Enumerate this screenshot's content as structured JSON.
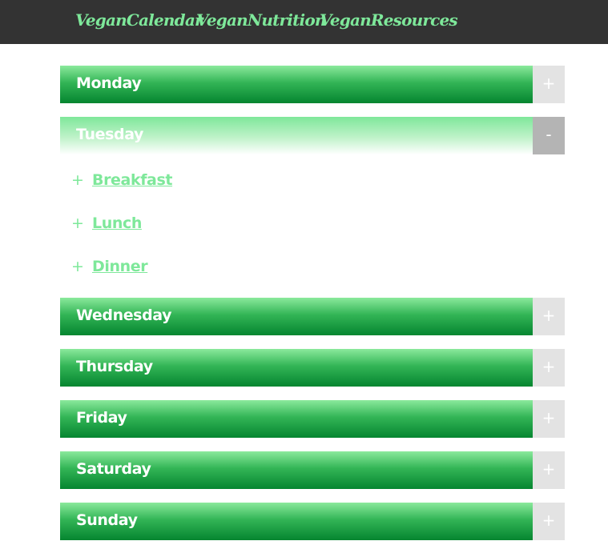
{
  "nav": {
    "items": [
      {
        "label": "VeganCalendar"
      },
      {
        "label": "VeganNutrition"
      },
      {
        "label": "VeganResources"
      }
    ]
  },
  "days": [
    {
      "label": "Monday",
      "toggle": "+",
      "expanded": false
    },
    {
      "label": "Tuesday",
      "toggle": "-",
      "expanded": true
    },
    {
      "label": "Wednesday",
      "toggle": "+",
      "expanded": false
    },
    {
      "label": "Thursday",
      "toggle": "+",
      "expanded": false
    },
    {
      "label": "Friday",
      "toggle": "+",
      "expanded": false
    },
    {
      "label": "Saturday",
      "toggle": "+",
      "expanded": false
    },
    {
      "label": "Sunday",
      "toggle": "+",
      "expanded": false
    }
  ],
  "tuesday_meals": [
    {
      "icon": "+",
      "label": "Breakfast"
    },
    {
      "icon": "+",
      "label": "Lunch"
    },
    {
      "icon": "+",
      "label": "Dinner"
    }
  ],
  "colors": {
    "nav_bg": "#333333",
    "nav_text": "#7ee89a",
    "bar_top": "#8be99c",
    "bar_bottom": "#058530",
    "toggle_bg": "#e3e3e3",
    "toggle_open_bg": "#b4b4b4",
    "meal_text": "#7ee89a"
  }
}
